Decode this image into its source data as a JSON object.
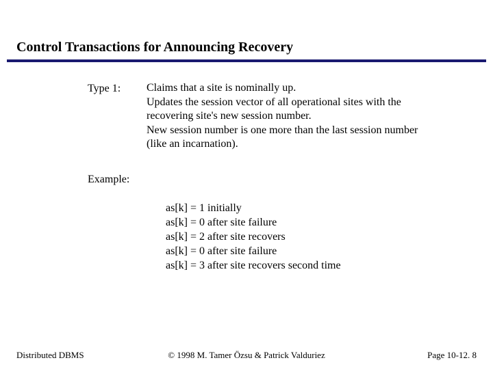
{
  "title": "Control Transactions for Announcing Recovery",
  "type1": {
    "label": "Type 1:",
    "paras": [
      "Claims that a site is nominally up.",
      "Updates the session vector of all operational sites with the recovering site's new session number.",
      "New session number is one more than the last session number (like an incarnation)."
    ]
  },
  "example": {
    "label": "Example:",
    "lines": [
      "as[k] = 1 initially",
      "as[k] = 0 after site failure",
      "as[k] = 2 after site recovers",
      "as[k] = 0 after site failure",
      "as[k] = 3 after site recovers second time"
    ]
  },
  "footer": {
    "left": "Distributed DBMS",
    "center": "© 1998 M. Tamer Özsu & Patrick Valduriez",
    "right": "Page 10-12. 8"
  }
}
